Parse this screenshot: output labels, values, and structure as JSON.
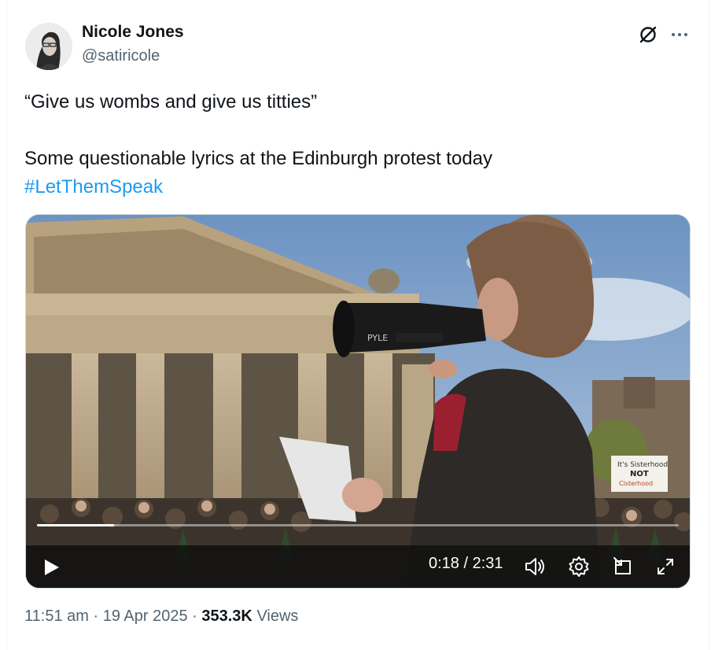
{
  "author": {
    "name": "Nicole Jones",
    "handle": "@satiricole"
  },
  "tweet": {
    "line1": "“Give us wombs and give us titties”",
    "line2": "Some questionable lyrics at the Edinburgh protest today",
    "hashtag": "#LetThemSpeak"
  },
  "video": {
    "time": "0:18 / 2:31",
    "progress_fraction": 0.12,
    "controls": [
      "play-icon",
      "volume-icon",
      "settings-icon",
      "pip-icon",
      "fullscreen-icon"
    ],
    "scene_text": {
      "megaphone_brand": "PYLE",
      "sign_line1": "It's Sisterhood",
      "sign_line2": "NOT",
      "sign_line3": "Cisterhood"
    }
  },
  "footer": {
    "time": "11:51 am",
    "sep1": "·",
    "date": "19 Apr 2025",
    "sep2": "·",
    "views_count": "353.3K",
    "views_label": "Views"
  },
  "colors": {
    "accent": "#1d9bf0",
    "text": "#0f1419",
    "secondary": "#536471"
  }
}
